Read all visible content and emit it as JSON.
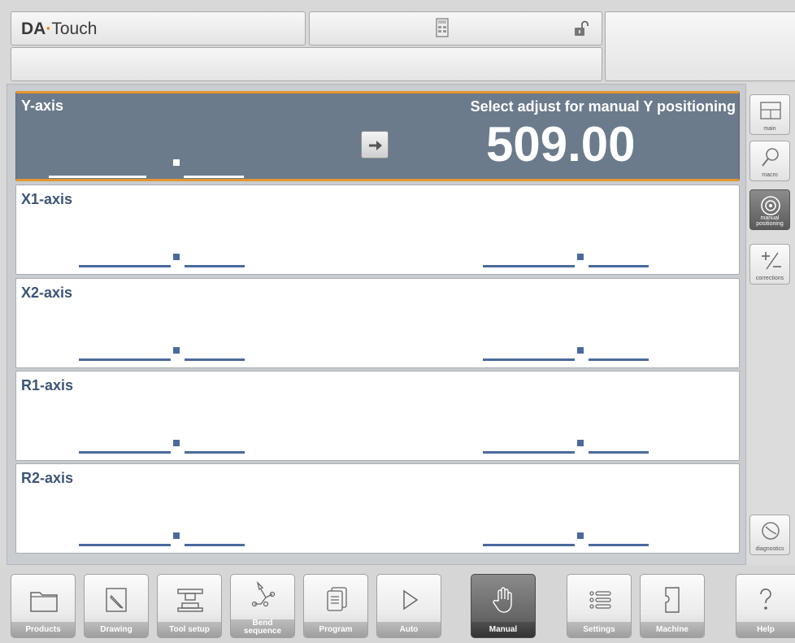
{
  "header": {
    "brand_bold": "DA",
    "brand_rest": "Touch",
    "message": ""
  },
  "axes": {
    "y": {
      "label": "Y-axis",
      "message": "Select adjust for manual Y positioning",
      "value": "509.00"
    },
    "x1": {
      "label": "X1-axis"
    },
    "x2": {
      "label": "X2-axis"
    },
    "r1": {
      "label": "R1-axis"
    },
    "r2": {
      "label": "R2-axis"
    }
  },
  "side_panel": {
    "main": "main",
    "macro": "macro",
    "manual_positioning": "manual positioning",
    "corrections": "corrections",
    "diagnostics": "diagnostics"
  },
  "bottom_nav": {
    "products": "Products",
    "drawing": "Drawing",
    "tool_setup": "Tool setup",
    "bend_sequence_1": "Bend",
    "bend_sequence_2": "sequence",
    "program": "Program",
    "auto": "Auto",
    "manual": "Manual",
    "settings": "Settings",
    "machine": "Machine",
    "help": "Help",
    "active": "Manual"
  },
  "colors": {
    "accent_orange": "#e5962f",
    "axis_blue": "#4a6a9e",
    "selected_panel": "#6b7b8c"
  }
}
